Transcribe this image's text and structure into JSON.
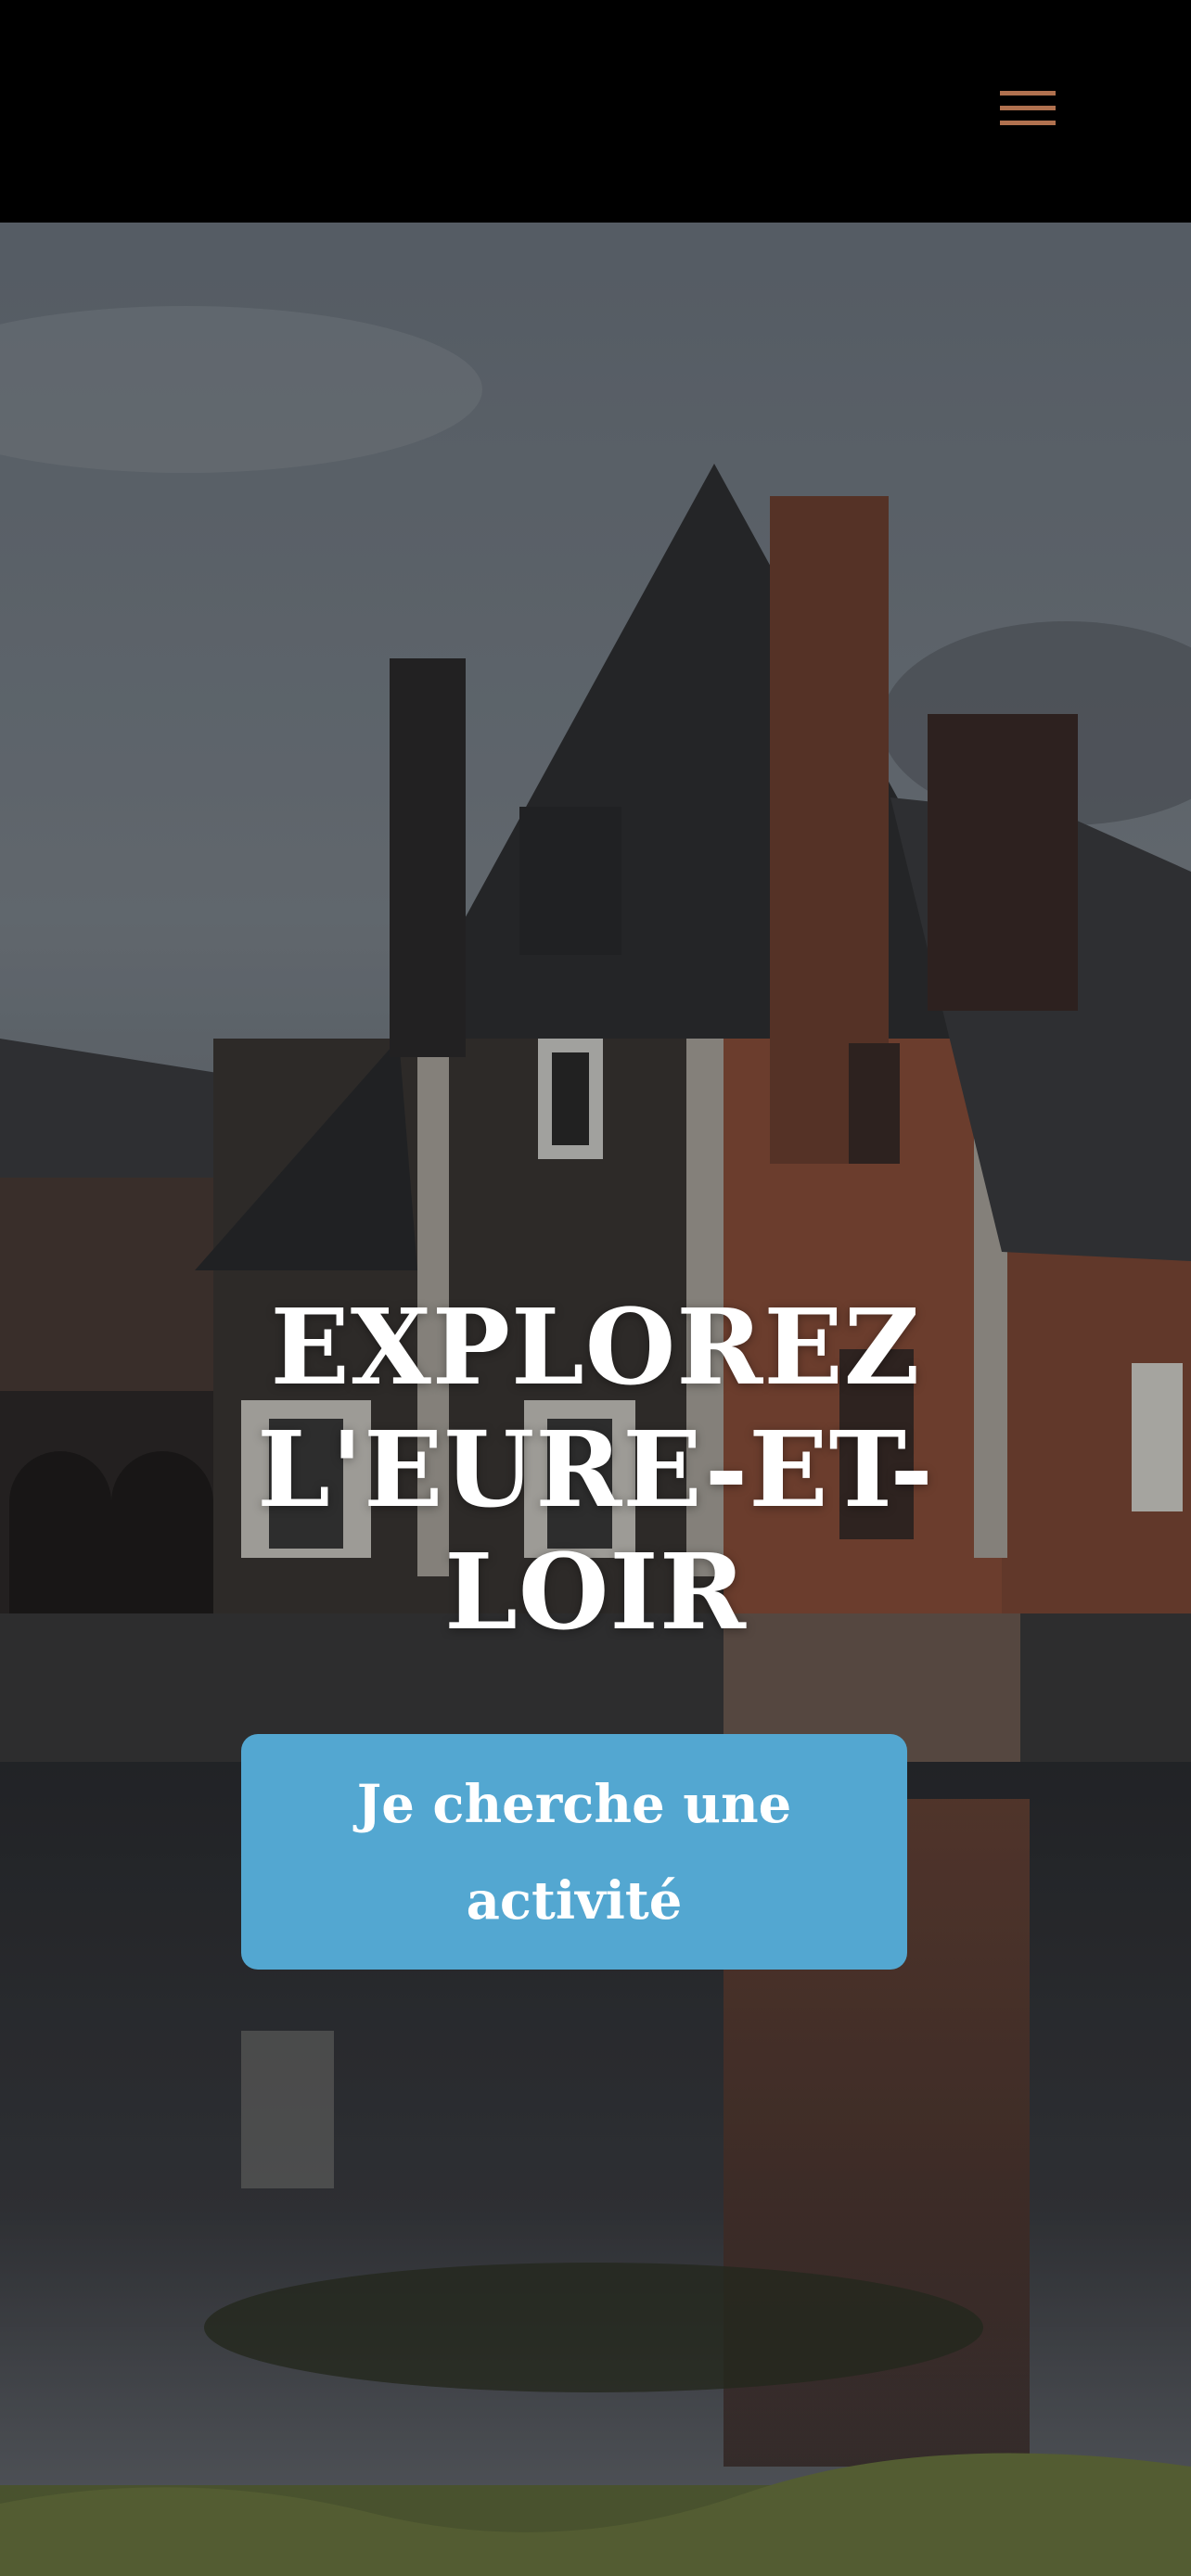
{
  "header": {
    "menu_icon": "hamburger-menu-icon",
    "menu_color": "#b0714f"
  },
  "hero": {
    "title": "EXPLOREZ L'EURE-ET-LOIR",
    "cta_label": "Je cherche une activité",
    "cta_color": "#53a7d1"
  }
}
